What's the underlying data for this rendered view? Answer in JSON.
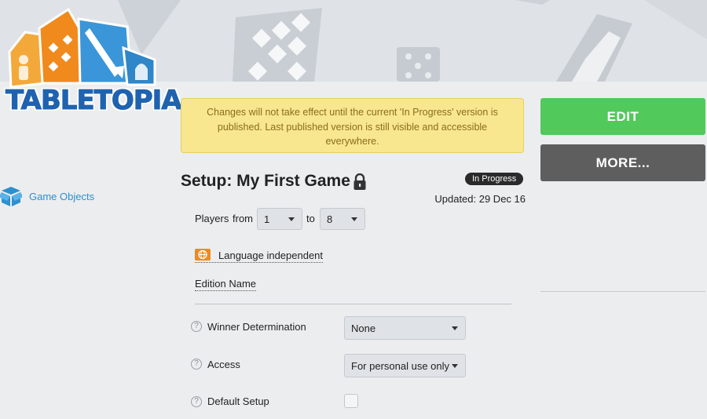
{
  "brand": {
    "logo_text": "TABLETOPIA"
  },
  "sidebar": {
    "items": [
      {
        "label": "Game Objects",
        "icon": "box-icon"
      }
    ]
  },
  "notice": {
    "text": "Changes will not take effect until the current 'In Progress' version is published. Last published version is still visible and accessible everywhere."
  },
  "actions": {
    "edit_label": "EDIT",
    "more_label": "MORE..."
  },
  "setup": {
    "title": "Setup: My First Game",
    "status": "In Progress",
    "updated": "Updated: 29 Dec 16",
    "players_label": "Players",
    "from_label": "from",
    "players_from": "1",
    "to_label": "to",
    "players_to": "8",
    "language": "Language independent",
    "edition_name": "Edition Name"
  },
  "options": {
    "winner_label": "Winner Determination",
    "winner_value": "None",
    "access_label": "Access",
    "access_value": "For personal use only",
    "default_setup_label": "Default Setup",
    "default_setup_checked": false,
    "help_glyph": "?"
  },
  "colors": {
    "edit": "#52c95b",
    "more": "#5e5e5e",
    "notice_bg": "#f8e78e",
    "link": "#2c8fcf",
    "badge": "#2a2a2a",
    "language_icon": "#f08a1c"
  }
}
